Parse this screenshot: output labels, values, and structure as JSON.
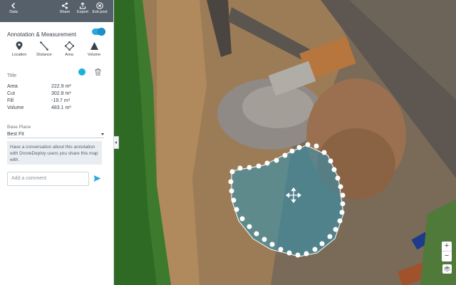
{
  "topbar": {
    "back_label": "Data",
    "share_label": "Share",
    "export_label": "Export",
    "exit_label": "Exit post"
  },
  "annotation": {
    "label": "Annotation & Measurement",
    "toggle_on": true
  },
  "tools": [
    {
      "label": "Location",
      "icon": "location-pin-icon"
    },
    {
      "label": "Distance",
      "icon": "distance-line-icon"
    },
    {
      "label": "Area",
      "icon": "area-polygon-icon"
    },
    {
      "label": "Volume",
      "icon": "volume-pyramid-icon"
    }
  ],
  "title_row": {
    "label": "Title",
    "color": "#1bb0e0"
  },
  "metrics": [
    {
      "label": "Area",
      "value": "222.9 m²"
    },
    {
      "label": "Cut",
      "value": "302.8 m³"
    },
    {
      "label": "Fill",
      "value": "-19.7 m³"
    },
    {
      "label": "Volume",
      "value": "483.1 m³"
    }
  ],
  "base_plane": {
    "label": "Base Plane",
    "selected": "Best Fit"
  },
  "info_text": "Have a conversation about this annotation with DroneDeploy users you share this map with.",
  "comment": {
    "placeholder": "Add a comment"
  },
  "colors": {
    "accent": "#2aa7e0",
    "topbar": "#56606b"
  }
}
